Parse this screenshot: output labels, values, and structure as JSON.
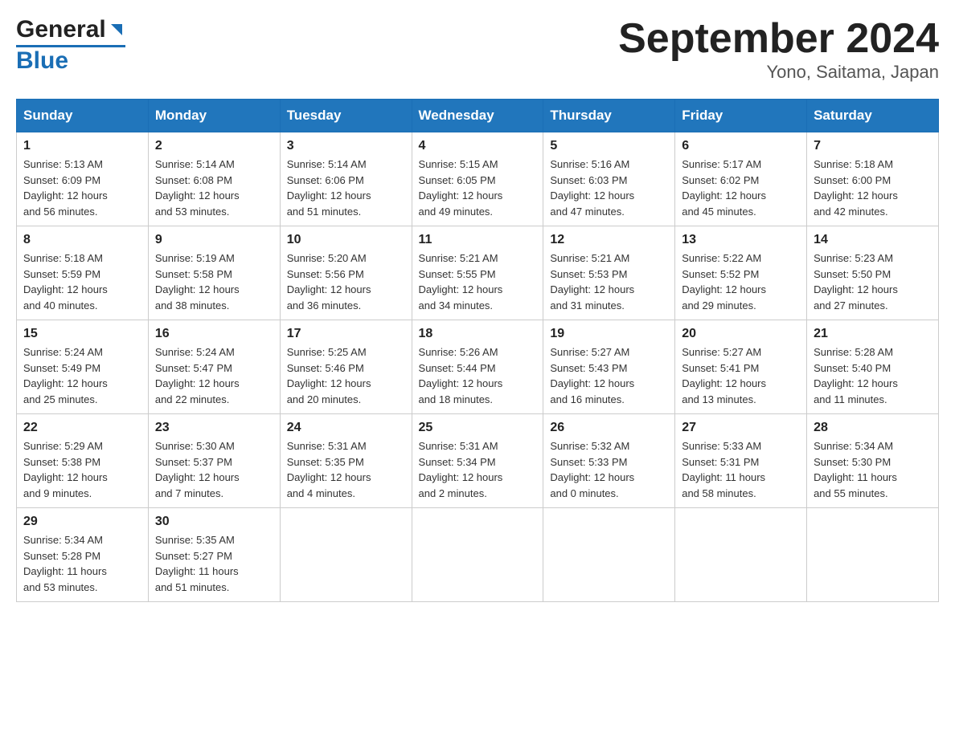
{
  "header": {
    "logo_general": "General",
    "logo_blue": "Blue",
    "title": "September 2024",
    "subtitle": "Yono, Saitama, Japan"
  },
  "days_of_week": [
    "Sunday",
    "Monday",
    "Tuesday",
    "Wednesday",
    "Thursday",
    "Friday",
    "Saturday"
  ],
  "weeks": [
    [
      {
        "day": "1",
        "sunrise": "5:13 AM",
        "sunset": "6:09 PM",
        "daylight": "12 hours and 56 minutes."
      },
      {
        "day": "2",
        "sunrise": "5:14 AM",
        "sunset": "6:08 PM",
        "daylight": "12 hours and 53 minutes."
      },
      {
        "day": "3",
        "sunrise": "5:14 AM",
        "sunset": "6:06 PM",
        "daylight": "12 hours and 51 minutes."
      },
      {
        "day": "4",
        "sunrise": "5:15 AM",
        "sunset": "6:05 PM",
        "daylight": "12 hours and 49 minutes."
      },
      {
        "day": "5",
        "sunrise": "5:16 AM",
        "sunset": "6:03 PM",
        "daylight": "12 hours and 47 minutes."
      },
      {
        "day": "6",
        "sunrise": "5:17 AM",
        "sunset": "6:02 PM",
        "daylight": "12 hours and 45 minutes."
      },
      {
        "day": "7",
        "sunrise": "5:18 AM",
        "sunset": "6:00 PM",
        "daylight": "12 hours and 42 minutes."
      }
    ],
    [
      {
        "day": "8",
        "sunrise": "5:18 AM",
        "sunset": "5:59 PM",
        "daylight": "12 hours and 40 minutes."
      },
      {
        "day": "9",
        "sunrise": "5:19 AM",
        "sunset": "5:58 PM",
        "daylight": "12 hours and 38 minutes."
      },
      {
        "day": "10",
        "sunrise": "5:20 AM",
        "sunset": "5:56 PM",
        "daylight": "12 hours and 36 minutes."
      },
      {
        "day": "11",
        "sunrise": "5:21 AM",
        "sunset": "5:55 PM",
        "daylight": "12 hours and 34 minutes."
      },
      {
        "day": "12",
        "sunrise": "5:21 AM",
        "sunset": "5:53 PM",
        "daylight": "12 hours and 31 minutes."
      },
      {
        "day": "13",
        "sunrise": "5:22 AM",
        "sunset": "5:52 PM",
        "daylight": "12 hours and 29 minutes."
      },
      {
        "day": "14",
        "sunrise": "5:23 AM",
        "sunset": "5:50 PM",
        "daylight": "12 hours and 27 minutes."
      }
    ],
    [
      {
        "day": "15",
        "sunrise": "5:24 AM",
        "sunset": "5:49 PM",
        "daylight": "12 hours and 25 minutes."
      },
      {
        "day": "16",
        "sunrise": "5:24 AM",
        "sunset": "5:47 PM",
        "daylight": "12 hours and 22 minutes."
      },
      {
        "day": "17",
        "sunrise": "5:25 AM",
        "sunset": "5:46 PM",
        "daylight": "12 hours and 20 minutes."
      },
      {
        "day": "18",
        "sunrise": "5:26 AM",
        "sunset": "5:44 PM",
        "daylight": "12 hours and 18 minutes."
      },
      {
        "day": "19",
        "sunrise": "5:27 AM",
        "sunset": "5:43 PM",
        "daylight": "12 hours and 16 minutes."
      },
      {
        "day": "20",
        "sunrise": "5:27 AM",
        "sunset": "5:41 PM",
        "daylight": "12 hours and 13 minutes."
      },
      {
        "day": "21",
        "sunrise": "5:28 AM",
        "sunset": "5:40 PM",
        "daylight": "12 hours and 11 minutes."
      }
    ],
    [
      {
        "day": "22",
        "sunrise": "5:29 AM",
        "sunset": "5:38 PM",
        "daylight": "12 hours and 9 minutes."
      },
      {
        "day": "23",
        "sunrise": "5:30 AM",
        "sunset": "5:37 PM",
        "daylight": "12 hours and 7 minutes."
      },
      {
        "day": "24",
        "sunrise": "5:31 AM",
        "sunset": "5:35 PM",
        "daylight": "12 hours and 4 minutes."
      },
      {
        "day": "25",
        "sunrise": "5:31 AM",
        "sunset": "5:34 PM",
        "daylight": "12 hours and 2 minutes."
      },
      {
        "day": "26",
        "sunrise": "5:32 AM",
        "sunset": "5:33 PM",
        "daylight": "12 hours and 0 minutes."
      },
      {
        "day": "27",
        "sunrise": "5:33 AM",
        "sunset": "5:31 PM",
        "daylight": "11 hours and 58 minutes."
      },
      {
        "day": "28",
        "sunrise": "5:34 AM",
        "sunset": "5:30 PM",
        "daylight": "11 hours and 55 minutes."
      }
    ],
    [
      {
        "day": "29",
        "sunrise": "5:34 AM",
        "sunset": "5:28 PM",
        "daylight": "11 hours and 53 minutes."
      },
      {
        "day": "30",
        "sunrise": "5:35 AM",
        "sunset": "5:27 PM",
        "daylight": "11 hours and 51 minutes."
      },
      null,
      null,
      null,
      null,
      null
    ]
  ],
  "labels": {
    "sunrise": "Sunrise:",
    "sunset": "Sunset:",
    "daylight": "Daylight:"
  }
}
